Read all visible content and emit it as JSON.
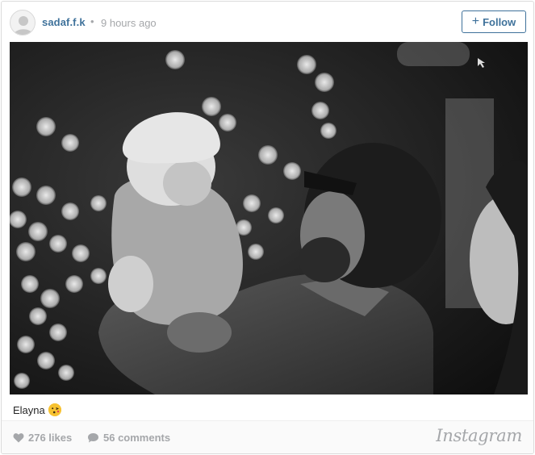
{
  "post": {
    "username": "sadaf.f.k",
    "separator": "•",
    "time_ago": "9 hours ago",
    "follow_label": "Follow",
    "follow_icon": "plus-icon",
    "caption": "Elayna",
    "caption_emoji": "kissing-face-emoji"
  },
  "photo": {
    "description_icon": "photo-image",
    "tone": "black-and-white"
  },
  "footer": {
    "likes": "276 likes",
    "likes_icon": "heart-icon",
    "comments": "56 comments",
    "comments_icon": "comment-icon",
    "brand": "Instagram"
  },
  "colors": {
    "link": "#3f729b",
    "muted": "#a5a7aa",
    "border": "#dbdbdb"
  }
}
